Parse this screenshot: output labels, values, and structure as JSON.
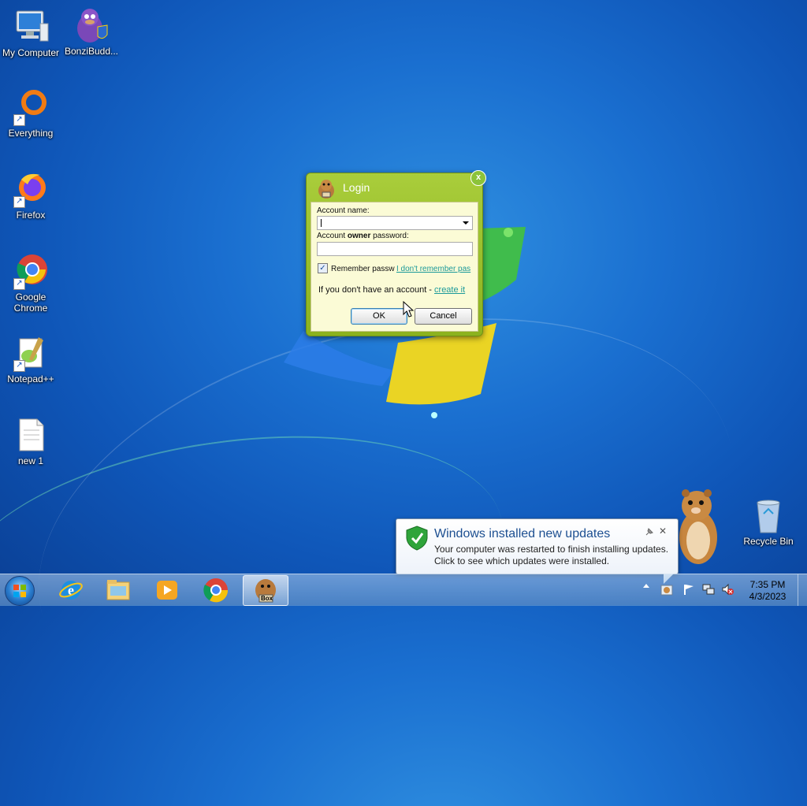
{
  "desktop": {
    "icons": [
      {
        "label": "My Computer",
        "icon": "computer-icon"
      },
      {
        "label": "BonziBudd...",
        "icon": "bonzibuddy-icon"
      },
      {
        "label": "Everything",
        "icon": "everything-icon"
      },
      {
        "label": "Firefox",
        "icon": "firefox-icon"
      },
      {
        "label": "Google Chrome",
        "icon": "chrome-icon"
      },
      {
        "label": "Notepad++",
        "icon": "notepadpp-icon"
      },
      {
        "label": "new 1",
        "icon": "text-file-icon"
      },
      {
        "label": "Recycle Bin",
        "icon": "recycle-bin-icon"
      }
    ]
  },
  "dialog": {
    "title": "Login",
    "close_label": "x",
    "account_name_label": "Account name:",
    "account_name_value": "",
    "password_label_pre": "Account ",
    "password_label_bold": "owner",
    "password_label_post": " password:",
    "password_value": "",
    "remember_checked": true,
    "remember_label": "Remember passw",
    "forgot_link": "I don't remember pas",
    "no_account_text": "If you don't have an account - ",
    "create_link": "create it",
    "ok_label": "OK",
    "cancel_label": "Cancel"
  },
  "notification": {
    "title": "Windows installed new updates",
    "line1": "Your computer was restarted to finish installing updates.",
    "line2": "Click to see which updates were installed.",
    "close_label": "✕"
  },
  "taskbar": {
    "items": [
      {
        "name": "internet-explorer",
        "icon": "ie-icon"
      },
      {
        "name": "file-explorer",
        "icon": "folder-icon"
      },
      {
        "name": "media-player",
        "icon": "media-player-icon"
      },
      {
        "name": "chrome",
        "icon": "chrome-icon"
      },
      {
        "name": "box-app",
        "icon": "box-icon",
        "label": "Box",
        "active": true
      }
    ],
    "clock_time": "7:35 PM",
    "clock_date": "4/3/2023"
  },
  "colors": {
    "dialog_green": "#a9cd3b",
    "dialog_panel": "#fbfbd6",
    "link": "#1c9a9a",
    "notif_title": "#1d4f91"
  }
}
